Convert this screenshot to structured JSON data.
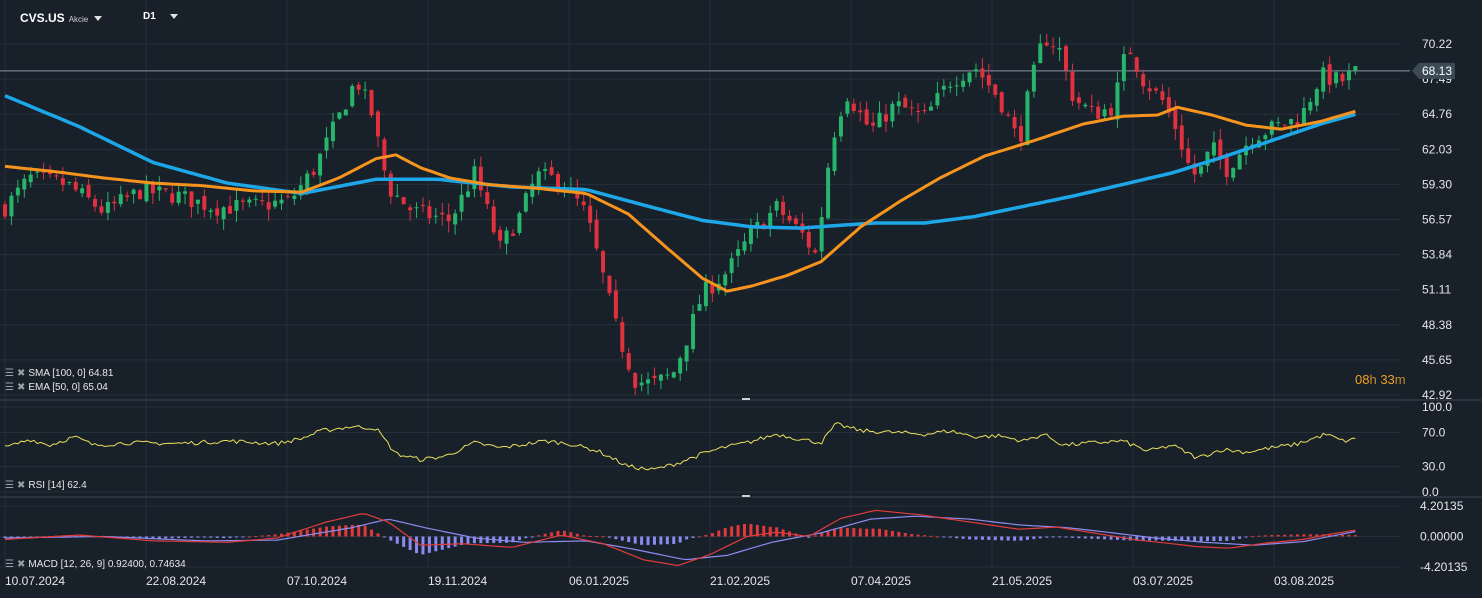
{
  "header": {
    "symbol": "CVS.US",
    "asset_type": "Akcie",
    "timeframe": "D1"
  },
  "legends": {
    "sma": "SMA [100, 0] 64.81",
    "ema": "EMA [50, 0] 65.04",
    "rsi": "RSI [14] 62.4",
    "macd": "MACD [12, 26, 9] 0.92400, 0.74634"
  },
  "countdown": {
    "hours": "08",
    "minutes": "33"
  },
  "colors": {
    "background": "#18202a",
    "grid": "#26303b",
    "bull": "#26b56a",
    "bear": "#e0313f",
    "sma": "#1ea7e8",
    "ema": "#f7941d",
    "rsi": "#e8e05a",
    "macd_line": "#e03c3c",
    "signal_line": "#8c8cf0",
    "hist_pos": "#e0393c",
    "hist_neg": "#8a8af0",
    "axis_text": "#e6e6e6",
    "price_badge": "#3c4a58"
  },
  "chart_data": [
    {
      "type": "candlestick",
      "title": "CVS.US D1",
      "x_ticks": [
        "10.07.2024",
        "22.08.2024",
        "07.10.2024",
        "19.11.2024",
        "06.01.2025",
        "21.02.2025",
        "07.04.2025",
        "21.05.2025",
        "03.07.2025",
        "03.08.2025"
      ],
      "y_ticks": [
        "70.22",
        "67.49",
        "64.76",
        "62.03",
        "59.30",
        "56.57",
        "53.84",
        "51.11",
        "48.38",
        "45.65",
        "42.92"
      ],
      "ylim": [
        42.92,
        72.0
      ],
      "last_price": "68.13",
      "close_waypoints": [
        [
          0,
          57.5
        ],
        [
          10,
          59.8
        ],
        [
          25,
          59.3
        ],
        [
          40,
          57.2
        ],
        [
          55,
          58.8
        ],
        [
          70,
          58.4
        ],
        [
          85,
          57.5
        ],
        [
          100,
          57.6
        ],
        [
          115,
          58.0
        ],
        [
          125,
          60.5
        ],
        [
          135,
          64.5
        ],
        [
          142,
          67.5
        ],
        [
          148,
          65.0
        ],
        [
          155,
          59.0
        ],
        [
          165,
          57.2
        ],
        [
          180,
          56.5
        ],
        [
          190,
          60.2
        ],
        [
          200,
          54.3
        ],
        [
          208,
          56.8
        ],
        [
          215,
          60.0
        ],
        [
          225,
          59.6
        ],
        [
          235,
          57.0
        ],
        [
          242,
          52.0
        ],
        [
          248,
          47.5
        ],
        [
          255,
          44.0
        ],
        [
          262,
          43.8
        ],
        [
          270,
          44.5
        ],
        [
          276,
          47.5
        ],
        [
          282,
          50.8
        ],
        [
          292,
          52.5
        ],
        [
          302,
          55.5
        ],
        [
          312,
          57.5
        ],
        [
          322,
          55.5
        ],
        [
          328,
          53.8
        ],
        [
          334,
          62.5
        ],
        [
          340,
          66.5
        ],
        [
          350,
          63.5
        ],
        [
          360,
          65.5
        ],
        [
          372,
          64.5
        ],
        [
          382,
          67.3
        ],
        [
          392,
          68.5
        ],
        [
          402,
          66.0
        ],
        [
          410,
          62.5
        ],
        [
          414,
          66.5
        ],
        [
          420,
          70.8
        ],
        [
          426,
          70.0
        ],
        [
          432,
          66.0
        ],
        [
          440,
          64.8
        ],
        [
          448,
          65.3
        ],
        [
          454,
          70.2
        ],
        [
          460,
          67.5
        ],
        [
          468,
          65.8
        ],
        [
          474,
          63.5
        ],
        [
          478,
          61.0
        ],
        [
          482,
          59.8
        ],
        [
          488,
          62.2
        ],
        [
          494,
          60.5
        ],
        [
          504,
          63.0
        ],
        [
          514,
          63.8
        ],
        [
          524,
          64.5
        ],
        [
          532,
          67.8
        ],
        [
          540,
          67.3
        ],
        [
          547,
          68.13
        ]
      ],
      "sma": {
        "name": "SMA [100, 0]",
        "last": 64.81,
        "waypoints": [
          [
            0,
            66.2
          ],
          [
            30,
            63.8
          ],
          [
            60,
            61.0
          ],
          [
            90,
            59.4
          ],
          [
            120,
            58.6
          ],
          [
            150,
            59.7
          ],
          [
            175,
            59.7
          ],
          [
            205,
            59.1
          ],
          [
            235,
            58.9
          ],
          [
            262,
            57.5
          ],
          [
            282,
            56.5
          ],
          [
            302,
            56.0
          ],
          [
            322,
            55.9
          ],
          [
            336,
            56.1
          ],
          [
            352,
            56.3
          ],
          [
            372,
            56.3
          ],
          [
            392,
            56.8
          ],
          [
            412,
            57.6
          ],
          [
            432,
            58.4
          ],
          [
            452,
            59.3
          ],
          [
            472,
            60.2
          ],
          [
            492,
            61.4
          ],
          [
            512,
            62.7
          ],
          [
            532,
            64.0
          ],
          [
            547,
            64.81
          ]
        ]
      },
      "ema": {
        "name": "EMA [50, 0]",
        "last": 65.04,
        "waypoints": [
          [
            0,
            60.7
          ],
          [
            20,
            60.3
          ],
          [
            40,
            59.8
          ],
          [
            60,
            59.4
          ],
          [
            80,
            59.2
          ],
          [
            100,
            58.8
          ],
          [
            120,
            58.7
          ],
          [
            135,
            59.8
          ],
          [
            150,
            61.3
          ],
          [
            158,
            61.6
          ],
          [
            168,
            60.6
          ],
          [
            180,
            59.8
          ],
          [
            195,
            59.3
          ],
          [
            215,
            59.0
          ],
          [
            235,
            58.6
          ],
          [
            252,
            57.0
          ],
          [
            268,
            54.3
          ],
          [
            282,
            52.0
          ],
          [
            292,
            51.0
          ],
          [
            302,
            51.4
          ],
          [
            316,
            52.2
          ],
          [
            330,
            53.3
          ],
          [
            346,
            56.0
          ],
          [
            362,
            58.0
          ],
          [
            378,
            59.8
          ],
          [
            396,
            61.5
          ],
          [
            416,
            62.7
          ],
          [
            436,
            64.0
          ],
          [
            452,
            64.6
          ],
          [
            466,
            64.7
          ],
          [
            474,
            65.3
          ],
          [
            488,
            64.7
          ],
          [
            502,
            63.9
          ],
          [
            516,
            63.6
          ],
          [
            532,
            64.2
          ],
          [
            547,
            65.04
          ]
        ]
      },
      "x_range": [
        0,
        560
      ],
      "note_x": "index of trading day from 10.07.2024"
    },
    {
      "type": "line",
      "title": "RSI [14]",
      "y_ticks": [
        "100.0",
        "70.0",
        "30.0",
        "0.0"
      ],
      "ylim": [
        0,
        100
      ],
      "last": 62.4,
      "waypoints": [
        [
          0,
          52
        ],
        [
          10,
          62
        ],
        [
          18,
          55
        ],
        [
          28,
          65
        ],
        [
          36,
          55
        ],
        [
          50,
          58
        ],
        [
          70,
          57
        ],
        [
          90,
          60
        ],
        [
          110,
          57
        ],
        [
          120,
          63
        ],
        [
          128,
          72
        ],
        [
          140,
          77
        ],
        [
          150,
          75
        ],
        [
          158,
          45
        ],
        [
          168,
          38
        ],
        [
          178,
          42
        ],
        [
          190,
          58
        ],
        [
          200,
          52
        ],
        [
          208,
          55
        ],
        [
          218,
          60
        ],
        [
          228,
          57
        ],
        [
          240,
          48
        ],
        [
          252,
          30
        ],
        [
          262,
          26
        ],
        [
          272,
          34
        ],
        [
          282,
          45
        ],
        [
          290,
          52
        ],
        [
          300,
          58
        ],
        [
          312,
          68
        ],
        [
          322,
          62
        ],
        [
          330,
          58
        ],
        [
          336,
          80
        ],
        [
          346,
          72
        ],
        [
          360,
          70
        ],
        [
          372,
          68
        ],
        [
          382,
          72
        ],
        [
          392,
          65
        ],
        [
          402,
          66
        ],
        [
          412,
          60
        ],
        [
          420,
          68
        ],
        [
          428,
          55
        ],
        [
          440,
          58
        ],
        [
          452,
          60
        ],
        [
          462,
          48
        ],
        [
          472,
          55
        ],
        [
          482,
          40
        ],
        [
          492,
          50
        ],
        [
          502,
          47
        ],
        [
          512,
          52
        ],
        [
          522,
          56
        ],
        [
          534,
          68
        ],
        [
          541,
          60
        ],
        [
          547,
          62.4
        ]
      ]
    },
    {
      "type": "bar",
      "title": "MACD [12, 26, 9]",
      "y_ticks": [
        "4.20135",
        "0.00000",
        "-4.20135"
      ],
      "ylim": [
        -4.20135,
        4.20135
      ],
      "macd_last": 0.924,
      "signal_last": 0.74634,
      "macd_waypoints": [
        [
          0,
          -0.4
        ],
        [
          30,
          0.2
        ],
        [
          60,
          -0.6
        ],
        [
          90,
          -0.8
        ],
        [
          110,
          -0.2
        ],
        [
          130,
          2.0
        ],
        [
          145,
          3.2
        ],
        [
          155,
          2.0
        ],
        [
          168,
          -1.2
        ],
        [
          185,
          -1.0
        ],
        [
          205,
          -1.5
        ],
        [
          225,
          0.2
        ],
        [
          242,
          -1.0
        ],
        [
          258,
          -3.2
        ],
        [
          272,
          -4.0
        ],
        [
          285,
          -2.5
        ],
        [
          300,
          0.0
        ],
        [
          312,
          0.6
        ],
        [
          325,
          0.0
        ],
        [
          338,
          2.5
        ],
        [
          352,
          3.6
        ],
        [
          370,
          3.0
        ],
        [
          390,
          2.0
        ],
        [
          410,
          1.0
        ],
        [
          425,
          1.3
        ],
        [
          440,
          0.5
        ],
        [
          458,
          -0.5
        ],
        [
          472,
          -1.0
        ],
        [
          482,
          -1.4
        ],
        [
          495,
          -1.6
        ],
        [
          510,
          -0.9
        ],
        [
          525,
          -0.4
        ],
        [
          537,
          0.4
        ],
        [
          547,
          0.924
        ]
      ],
      "signal_waypoints": [
        [
          0,
          -0.2
        ],
        [
          40,
          0.0
        ],
        [
          80,
          -0.6
        ],
        [
          110,
          -0.5
        ],
        [
          140,
          1.2
        ],
        [
          155,
          2.4
        ],
        [
          170,
          1.2
        ],
        [
          190,
          -0.2
        ],
        [
          210,
          -0.8
        ],
        [
          235,
          -0.6
        ],
        [
          255,
          -1.8
        ],
        [
          275,
          -3.2
        ],
        [
          292,
          -2.6
        ],
        [
          310,
          -0.8
        ],
        [
          330,
          0.5
        ],
        [
          350,
          2.4
        ],
        [
          368,
          2.8
        ],
        [
          390,
          2.4
        ],
        [
          410,
          1.6
        ],
        [
          430,
          1.2
        ],
        [
          448,
          0.5
        ],
        [
          465,
          -0.2
        ],
        [
          485,
          -0.8
        ],
        [
          505,
          -1.2
        ],
        [
          525,
          -0.7
        ],
        [
          540,
          0.3
        ],
        [
          547,
          0.74634
        ]
      ]
    }
  ]
}
